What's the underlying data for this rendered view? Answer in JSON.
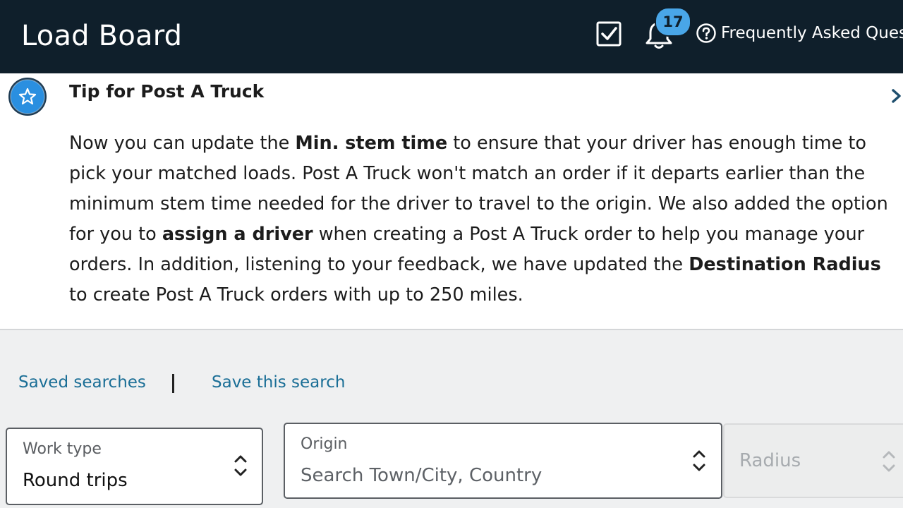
{
  "header": {
    "title": "Load Board",
    "notification_count": "17",
    "faq_label": "Frequently Asked Questions"
  },
  "tip": {
    "title": "Tip for Post A Truck",
    "p1": "Now you can update the ",
    "b1": "Min. stem time",
    "p2": " to ensure that your driver has enough time to pick your matched loads. Post A Truck won't match an order if it departs earlier than the minimum stem time needed for the driver to travel to the origin. We also added the option for you to ",
    "b2": "assign a driver",
    "p3": " when creating a Post A Truck order to help you manage your orders. In addition, listening to your feedback, we have updated the ",
    "b3": "Destination Radius",
    "p4": " to create Post A Truck orders with up to 250 miles."
  },
  "search": {
    "saved_searches": "Saved searches",
    "separator": "|",
    "save_this_search": "Save this search"
  },
  "filters": {
    "work_type_label": "Work type",
    "work_type_value": "Round trips",
    "origin_label": "Origin",
    "origin_placeholder": "Search Town/City, Country",
    "radius_placeholder": "Radius"
  },
  "colors": {
    "header_bg": "#0f1f2b",
    "badge_bg": "#49a6e8",
    "link": "#1a6e96",
    "tip_icon": "#2a8fe0"
  },
  "icons": {
    "tasks": "checkbox-icon",
    "notifications": "bell-icon",
    "faq": "question-circle-icon",
    "tip": "star-icon",
    "close": "chevron-right-icon",
    "select": "up-down-chevron-icon"
  }
}
